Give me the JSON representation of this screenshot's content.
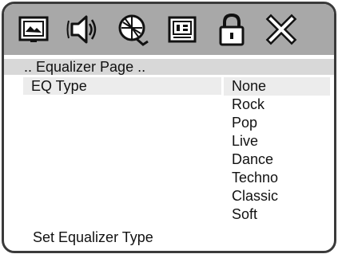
{
  "toolbar": {
    "icons": [
      {
        "name": "general-setup-icon"
      },
      {
        "name": "audio-setup-icon"
      },
      {
        "name": "video-setup-icon"
      },
      {
        "name": "preference-icon"
      },
      {
        "name": "password-lock-icon"
      },
      {
        "name": "exit-icon"
      }
    ]
  },
  "page": {
    "title": ".. Equalizer Page .."
  },
  "setting": {
    "label": "EQ Type",
    "selected": "None",
    "options": [
      "None",
      "Rock",
      "Pop",
      "Live",
      "Dance",
      "Techno",
      "Classic",
      "Soft"
    ]
  },
  "status": {
    "text": "Set Equalizer Type"
  },
  "colors": {
    "toolbar_bg": "#a8a8a8",
    "title_bg": "#d8d8d8",
    "highlight": "#ececec",
    "frame": "#3a3a3a"
  }
}
